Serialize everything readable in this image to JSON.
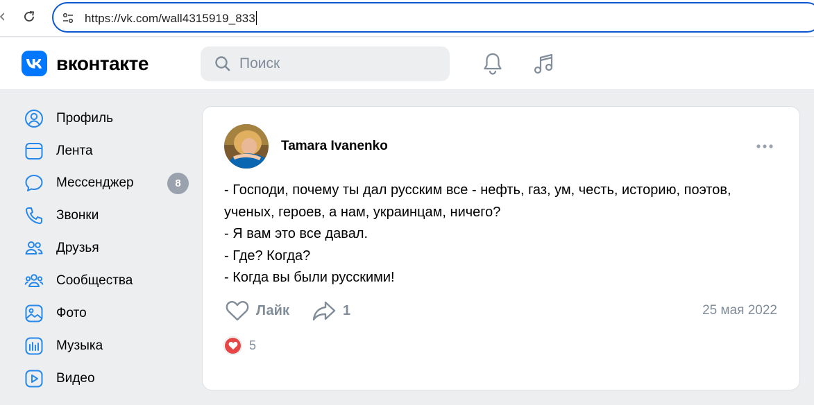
{
  "browser": {
    "url": "https://vk.com/wall4315919_833",
    "icons": {
      "reload": "reload-icon",
      "site_info": "tune-icon"
    }
  },
  "header": {
    "logo_text": "вконтакте",
    "search_placeholder": "Поиск",
    "icons": [
      "search-icon",
      "bell-icon",
      "music-note-icon"
    ],
    "brand_color": "#0077ff"
  },
  "sidebar": {
    "items": [
      {
        "label": "Профиль",
        "icon": "profile-icon"
      },
      {
        "label": "Лента",
        "icon": "feed-icon"
      },
      {
        "label": "Мессенджер",
        "icon": "chat-bubble-icon",
        "badge": "8"
      },
      {
        "label": "Звонки",
        "icon": "phone-icon"
      },
      {
        "label": "Друзья",
        "icon": "friends-icon"
      },
      {
        "label": "Сообщества",
        "icon": "communities-icon"
      },
      {
        "label": "Фото",
        "icon": "photo-icon"
      },
      {
        "label": "Музыка",
        "icon": "music-icon"
      },
      {
        "label": "Видео",
        "icon": "video-icon"
      }
    ]
  },
  "post": {
    "author": "Tamara Ivanenko",
    "lines": [
      "- Господи, почему ты дал русским все - нефть, газ, ум, честь, историю, поэтов,",
      "ученых, героев, а нам, украинцам, ничего?",
      "- Я вам это все давал.",
      "- Где? Когда?",
      "- Когда вы были русскими!"
    ],
    "like_label": "Лайк",
    "share_count": "1",
    "date": "25 мая 2022",
    "reaction_count": "5",
    "reaction_color": "#e64646"
  }
}
